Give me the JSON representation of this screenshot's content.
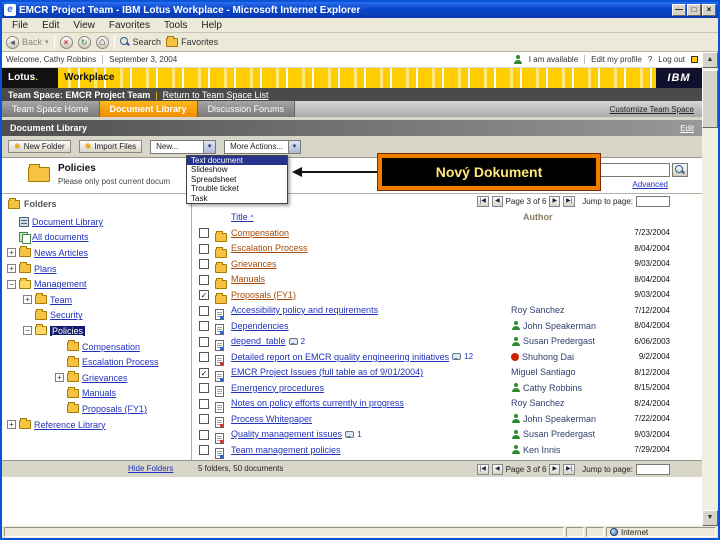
{
  "window": {
    "title": "EMCR Project Team - IBM Lotus Workplace - Microsoft Internet Explorer",
    "menu_items": [
      "File",
      "Edit",
      "View",
      "Favorites",
      "Tools",
      "Help"
    ],
    "toolbar": {
      "back_label": "Back",
      "search_label": "Search",
      "favorites_label": "Favorites"
    },
    "status_zone": "Internet"
  },
  "userbar": {
    "welcome": "Welcome, Cathy Robbins",
    "date": "September 3, 2004",
    "availability": "I am available",
    "edit_profile": "Edit my profile",
    "help": "?",
    "logout": "Log out"
  },
  "brand": {
    "lotus": "Lotus",
    "lotus_dot": ".",
    "workplace": "Workplace",
    "ibm": "IBM"
  },
  "teamspace": {
    "title": "Team Space: EMCR Project Team",
    "separator": "|",
    "return_link": "Return to Team Space List",
    "tabs": [
      {
        "label": "Team Space Home",
        "active": false
      },
      {
        "label": "Document Library",
        "active": true
      },
      {
        "label": "Discussion Forums",
        "active": false
      }
    ],
    "customize_link": "Customize Team Space"
  },
  "doclib": {
    "header": "Document Library",
    "edit_link": "Edit",
    "new_folder_btn": "New Folder",
    "import_files_btn": "Import Files",
    "new_select": "New...",
    "more_actions_select": "More Actions...",
    "new_menu": [
      {
        "label": "Text document",
        "selected": true
      },
      {
        "label": "Slideshow",
        "selected": false
      },
      {
        "label": "Spreadsheet",
        "selected": false
      },
      {
        "label": "Trouble ticket",
        "selected": false
      },
      {
        "label": "Task",
        "selected": false
      }
    ],
    "callout_text": "Nový Dokument",
    "callout_border_color": "#ef7d00",
    "callout_bg_color": "#000000",
    "folder_title": "Policies",
    "folder_desc": "Please only post current docum",
    "advanced_link": "Advanced"
  },
  "folders": {
    "panel_title": "Folders",
    "hide_link": "Hide Folders",
    "tree": [
      {
        "label": "Document Library",
        "indent": 0,
        "expander": "",
        "icon": "doclib",
        "selected": false
      },
      {
        "label": "All documents",
        "indent": 0,
        "expander": "",
        "icon": "alldocs",
        "selected": false
      },
      {
        "label": "News Articles",
        "indent": 0,
        "expander": "+",
        "icon": "folder",
        "selected": false
      },
      {
        "label": "Plans",
        "indent": 0,
        "expander": "+",
        "icon": "folder",
        "selected": false
      },
      {
        "label": "Management",
        "indent": 0,
        "expander": "-",
        "icon": "folder-open",
        "selected": false
      },
      {
        "label": "Team",
        "indent": 1,
        "expander": "+",
        "icon": "folder",
        "selected": false
      },
      {
        "label": "Security",
        "indent": 1,
        "expander": "",
        "icon": "folder",
        "selected": false
      },
      {
        "label": "Policies",
        "indent": 1,
        "expander": "-",
        "icon": "folder-open",
        "selected": true
      },
      {
        "label": "Compensation",
        "indent": 2,
        "expander": "",
        "icon": "folder",
        "selected": false
      },
      {
        "label": "Escalation Process",
        "indent": 2,
        "expander": "",
        "icon": "folder",
        "selected": false
      },
      {
        "label": "Grievances",
        "indent": 2,
        "expander": "+",
        "icon": "folder",
        "selected": false
      },
      {
        "label": "Manuals",
        "indent": 2,
        "expander": "",
        "icon": "folder",
        "selected": false
      },
      {
        "label": "Proposals (FY1)",
        "indent": 2,
        "expander": "",
        "icon": "folder",
        "selected": false
      },
      {
        "label": "Reference Library",
        "indent": 0,
        "expander": "+",
        "icon": "folder",
        "selected": false
      }
    ]
  },
  "table": {
    "col_title": "Title",
    "sort_indicator": "^",
    "col_author": "Author",
    "summary": "5 folders, 50 documents",
    "pager": {
      "first": "|◀",
      "prev": "◀",
      "label": "Page 3 of 6",
      "next": "▶",
      "last": "▶|",
      "jump_label": "Jump to page:"
    },
    "rows": [
      {
        "checked": false,
        "icon": "folder",
        "title": "Compensation",
        "comments": "",
        "author": "",
        "author_icon": "",
        "date": "7/23/2004"
      },
      {
        "checked": false,
        "icon": "folder",
        "title": "Escalation Process",
        "comments": "",
        "author": "",
        "author_icon": "",
        "date": "8/04/2004"
      },
      {
        "checked": false,
        "icon": "folder",
        "title": "Grievances",
        "comments": "",
        "author": "",
        "author_icon": "",
        "date": "9/03/2004"
      },
      {
        "checked": false,
        "icon": "folder",
        "title": "Manuals",
        "comments": "",
        "author": "",
        "author_icon": "",
        "date": "8/04/2004"
      },
      {
        "checked": true,
        "icon": "folder",
        "title": "Proposals (FY1)",
        "comments": "",
        "author": "",
        "author_icon": "",
        "date": "9/03/2004"
      },
      {
        "checked": false,
        "icon": "doc-blue",
        "title": "Accessibility policy and requirements",
        "comments": "",
        "author": "Roy Sanchez",
        "author_icon": "",
        "date": "7/12/2004"
      },
      {
        "checked": false,
        "icon": "doc-blue",
        "title": "Dependencies",
        "comments": "",
        "author": "John Speakerman",
        "author_icon": "person-green",
        "date": "8/04/2004"
      },
      {
        "checked": false,
        "icon": "doc-blue",
        "title": "depend_table",
        "comments": "2",
        "author": "Susan Predergast",
        "author_icon": "person-green",
        "date": "6/06/2003"
      },
      {
        "checked": false,
        "icon": "doc-red",
        "title": "Detailed report on EMCR quality engineering initiatives",
        "comments": "12",
        "author": "Shuhong Dai",
        "author_icon": "person-red",
        "date": "9/2/2004"
      },
      {
        "checked": true,
        "icon": "doc-blue",
        "title": "EMCR Project Issues (full table as of 9/01/2004)",
        "comments": "",
        "author": "Miguel Santiago",
        "author_icon": "",
        "date": "8/12/2004"
      },
      {
        "checked": false,
        "icon": "doc-plain",
        "title": "Emergency procedures",
        "comments": "",
        "author": "Cathy Robbins",
        "author_icon": "person-green",
        "date": "8/15/2004"
      },
      {
        "checked": false,
        "icon": "doc-plain",
        "title": "Notes on policy efforts currently in progress",
        "comments": "",
        "author": "Roy Sanchez",
        "author_icon": "",
        "date": "8/24/2004"
      },
      {
        "checked": false,
        "icon": "doc-red",
        "title": "Process Whitepaper",
        "comments": "",
        "author": "John Speakerman",
        "author_icon": "person-green",
        "date": "7/22/2004"
      },
      {
        "checked": false,
        "icon": "doc-red",
        "title": "Quality management issues",
        "comments": "1",
        "author": "Susan Predergast",
        "author_icon": "person-green",
        "date": "9/03/2004"
      },
      {
        "checked": false,
        "icon": "doc-blue",
        "title": "Team management policies",
        "comments": "",
        "author": "Ken Innis",
        "author_icon": "person-green",
        "date": "7/29/2004"
      }
    ]
  }
}
